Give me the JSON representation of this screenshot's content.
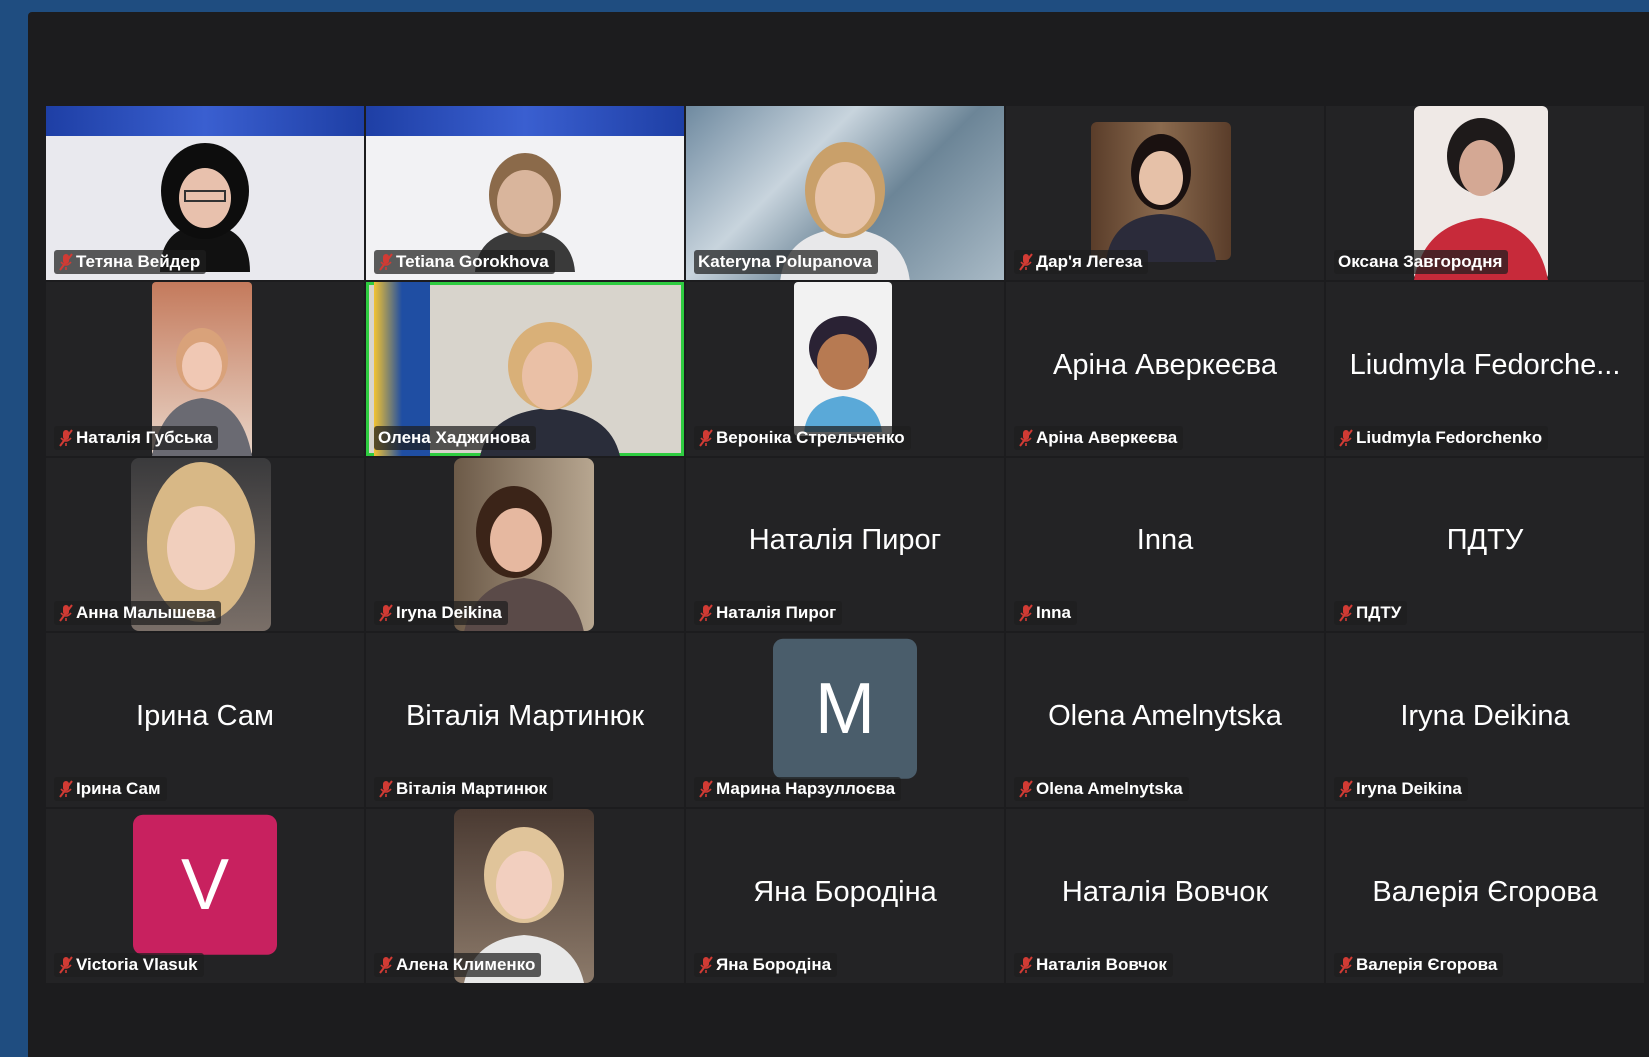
{
  "colors": {
    "frame_bg": "#1c1c1e",
    "tile_bg": "#232325",
    "active_border": "#2ecc40",
    "mute_icon": "#d13b34",
    "outer_bg": "#1f4d80"
  },
  "participants": [
    {
      "name": "Тетяна Вейдер",
      "video": true,
      "muted": true
    },
    {
      "name": "Tetiana Gorokhova",
      "video": true,
      "muted": true
    },
    {
      "name": "Kateryna Polupanova",
      "video": true,
      "muted": false
    },
    {
      "name": "Дар'я Легеза",
      "video": true,
      "muted": true
    },
    {
      "name": "Оксана Завгородня",
      "video": true,
      "muted": false
    },
    {
      "name": "Наталія Губська",
      "video": true,
      "muted": true
    },
    {
      "name": "Олена Хаджинова",
      "video": true,
      "muted": false,
      "active_speaker": true
    },
    {
      "name": "Вероніка Стрельченко",
      "video": true,
      "muted": true
    },
    {
      "name": "Аріна Аверкеєва",
      "display": "Аріна Аверкеєва",
      "video": false,
      "muted": true
    },
    {
      "name": "Liudmyla Fedorchenko",
      "display": "Liudmyla Fedorche...",
      "video": false,
      "muted": true
    },
    {
      "name": "Анна Малышева",
      "video": true,
      "muted": true
    },
    {
      "name": "Iryna Deikina",
      "video": true,
      "muted": true
    },
    {
      "name": "Наталія Пирог",
      "display": "Наталія Пирог",
      "video": false,
      "muted": true
    },
    {
      "name": "Inna",
      "display": "Inna",
      "video": false,
      "muted": true
    },
    {
      "name": "ПДТУ",
      "display": "ПДТУ",
      "video": false,
      "muted": true
    },
    {
      "name": "Ірина Сам",
      "display": "Ірина Сам",
      "video": false,
      "muted": true
    },
    {
      "name": "Віталія Мартинюк",
      "display": "Віталія Мартинюк",
      "video": false,
      "muted": true
    },
    {
      "name": "Марина Нарзуллоєва",
      "avatar_letter": "M",
      "avatar_color": "#4a5d6b",
      "video": false,
      "muted": true
    },
    {
      "name": "Olena Amelnytska",
      "display": "Olena Amelnytska",
      "video": false,
      "muted": true
    },
    {
      "name": "Iryna Deikina",
      "display": "Iryna Deikina",
      "video": false,
      "muted": true
    },
    {
      "name": "Victoria Vlasuk",
      "avatar_letter": "V",
      "avatar_color": "#c8215f",
      "video": false,
      "muted": true
    },
    {
      "name": "Алена Клименко",
      "video": true,
      "muted": true
    },
    {
      "name": "Яна Бородіна",
      "display": "Яна Бородіна",
      "video": false,
      "muted": true
    },
    {
      "name": "Наталія Вовчок",
      "display": "Наталія Вовчок",
      "video": false,
      "muted": true
    },
    {
      "name": "Валерія Єгорова",
      "display": "Валерія Єгорова",
      "video": false,
      "muted": true
    }
  ]
}
